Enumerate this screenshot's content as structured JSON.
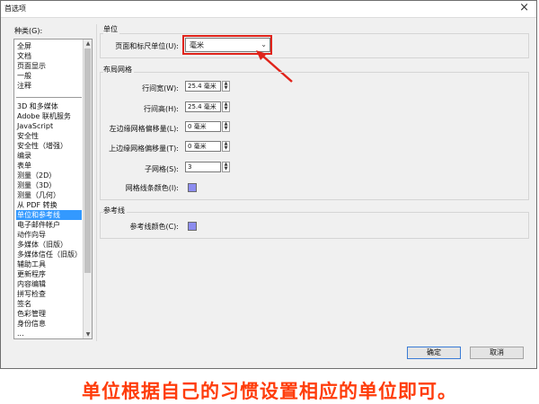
{
  "window": {
    "title": "首选项",
    "close_glyph": "×"
  },
  "categories": {
    "label": "种类(G):",
    "top_items": [
      "全屏",
      "文档",
      "页面显示",
      "一般",
      "注释"
    ],
    "items": [
      "3D 和多媒体",
      "Adobe 联机服务",
      "JavaScript",
      "安全性",
      "安全性（增强）",
      "编录",
      "表单",
      "测量（2D）",
      "测量（3D）",
      "测量（几何）",
      "从 PDF 转换",
      "单位和参考线",
      "电子邮件帐户",
      "动作向导",
      "多媒体（旧版）",
      "多媒体信任（旧版）",
      "辅助工具",
      "更新程序",
      "内容编辑",
      "拼写检查",
      "签名",
      "色彩管理",
      "身份信息",
      "..."
    ],
    "selected": "单位和参考线"
  },
  "units": {
    "group_title": "单位",
    "page_ruler_label": "页面和标尺单位(U):",
    "page_ruler_value": "毫米"
  },
  "layout_grid": {
    "group_title": "布局网格",
    "rows": [
      {
        "label": "行间宽(W):",
        "value": "25.4 毫米"
      },
      {
        "label": "行间高(H):",
        "value": "25.4 毫米"
      },
      {
        "label": "左边缘网格偏移量(L):",
        "value": "0 毫米"
      },
      {
        "label": "上边缘网格偏移量(T):",
        "value": "0 毫米"
      },
      {
        "label": "子网格(S):",
        "value": "3"
      }
    ],
    "line_color_label": "网格线条颜色(I):",
    "line_color": "#8c8cf0"
  },
  "guides": {
    "group_title": "参考线",
    "color_label": "参考线颜色(C):",
    "color": "#8c8cf0"
  },
  "buttons": {
    "ok": "确定",
    "cancel": "取消"
  },
  "annotation": {
    "caption": "单位根据自己的习惯设置相应的单位即可。",
    "color": "#ff3c0a"
  }
}
